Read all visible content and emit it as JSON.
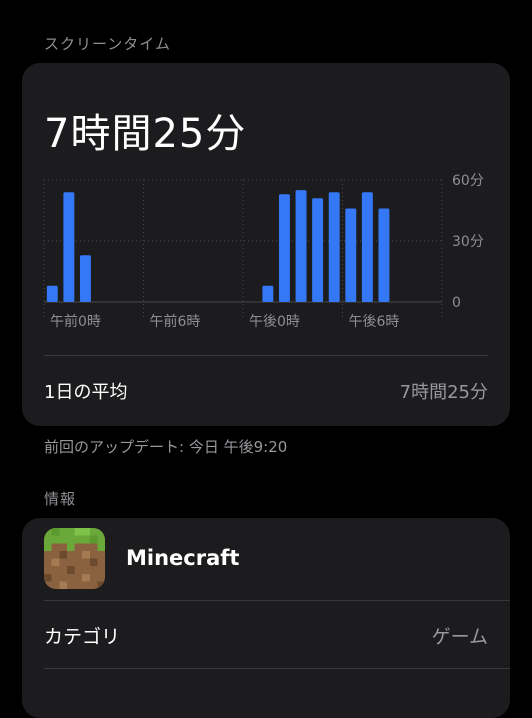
{
  "screen_time": {
    "section_title": "スクリーンタイム",
    "total": "7時間25分",
    "daily_average_label": "1日の平均",
    "daily_average_value": "7時間25分"
  },
  "last_updated": "前回のアップデート: 今日 午後9:20",
  "chart_data": {
    "type": "bar",
    "x": [
      0,
      1,
      2,
      13,
      14,
      15,
      16,
      17,
      18,
      19,
      20
    ],
    "values": [
      8,
      54,
      23,
      8,
      53,
      55,
      51,
      54,
      46,
      54,
      46
    ],
    "xlim": [
      0,
      24
    ],
    "x_tick_labels": [
      "午前0時",
      "午前6時",
      "午後0時",
      "午後6時"
    ],
    "y_tick_labels": [
      "60分",
      "30分",
      "0"
    ],
    "ylim": [
      0,
      60
    ],
    "color": "#3478f6"
  },
  "info": {
    "section_title": "情報",
    "app_name": "Minecraft",
    "category_label": "カテゴリ",
    "category_value": "ゲーム"
  }
}
